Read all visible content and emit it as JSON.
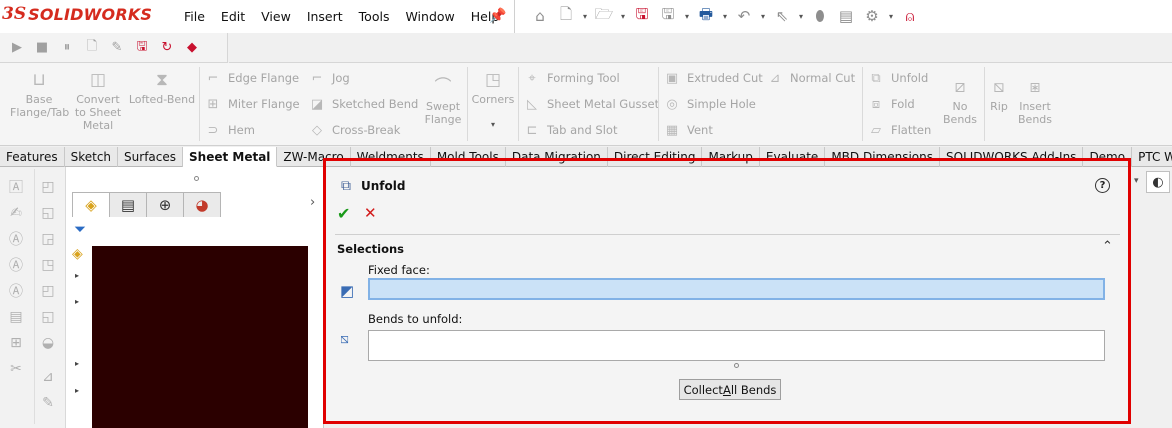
{
  "app": {
    "logo_ds": "3S",
    "logo_text": "SOLIDWORKS"
  },
  "menu": [
    "File",
    "Edit",
    "View",
    "Insert",
    "Tools",
    "Window",
    "Help"
  ],
  "command_manager": {
    "base_flange": "Base Flange/Tab",
    "convert": "Convert to Sheet Metal",
    "lofted_bend": "Lofted-Bend",
    "edge_flange": "Edge Flange",
    "miter_flange": "Miter Flange",
    "hem": "Hem",
    "jog": "Jog",
    "sketched_bend": "Sketched Bend",
    "cross_break": "Cross-Break",
    "swept_flange": "Swept Flange",
    "corners": "Corners",
    "forming_tool": "Forming Tool",
    "sheet_metal_gusset": "Sheet Metal Gusset",
    "tab_and_slot": "Tab and Slot",
    "extruded_cut": "Extruded Cut",
    "simple_hole": "Simple Hole",
    "vent": "Vent",
    "normal_cut": "Normal Cut",
    "unfold": "Unfold",
    "fold": "Fold",
    "flatten": "Flatten",
    "no_bends": "No Bends",
    "rip": "Rip",
    "insert_bends": "Insert Bends"
  },
  "tabs": [
    {
      "label": "Features",
      "active": false
    },
    {
      "label": "Sketch",
      "active": false
    },
    {
      "label": "Surfaces",
      "active": false
    },
    {
      "label": "Sheet Metal",
      "active": true
    },
    {
      "label": "ZW-Macro",
      "active": false
    },
    {
      "label": "Weldments",
      "active": false
    },
    {
      "label": "Mold Tools",
      "active": false
    },
    {
      "label": "Data Migration",
      "active": false
    },
    {
      "label": "Direct Editing",
      "active": false
    },
    {
      "label": "Markup",
      "active": false
    },
    {
      "label": "Evaluate",
      "active": false
    },
    {
      "label": "MBD Dimensions",
      "active": false
    },
    {
      "label": "SOLIDWORKS Add-Ins",
      "active": false
    },
    {
      "label": "Demo",
      "active": false
    },
    {
      "label": "PTC Windchill",
      "active": false
    }
  ],
  "property_manager": {
    "title": "Unfold",
    "help": "?",
    "ok": "✔",
    "cancel": "✕",
    "section_title": "Selections",
    "collapse": "⌃",
    "fixed_face_label": "Fixed face:",
    "fixed_face_value": "",
    "bends_label": "Bends to unfold:",
    "collect_button_prefix": "Collect ",
    "collect_button_mnemonic": "A",
    "collect_button_suffix": "ll Bends"
  },
  "colors": {
    "highlight_box": "#e00000",
    "graphics_area": "#2b0000",
    "active_input": "#cbe2f7",
    "brand": "#d52b1e"
  }
}
